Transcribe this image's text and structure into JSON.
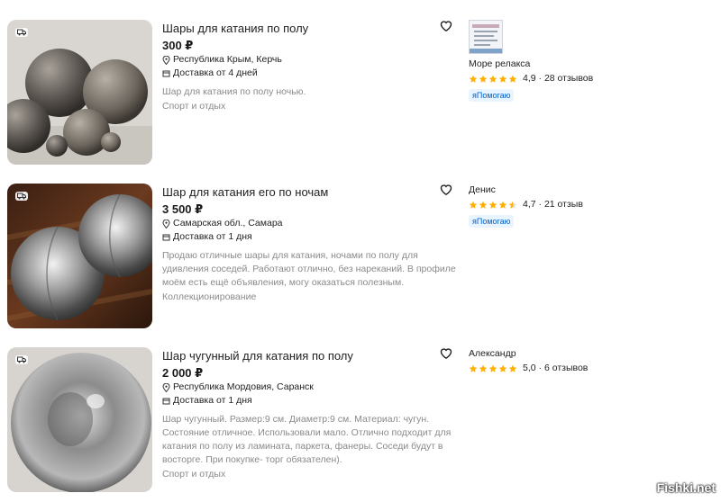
{
  "listings": [
    {
      "title": "Шары для катания по полу",
      "price": "300 ₽",
      "location": "Республика Крым, Керчь",
      "delivery": "Доставка от 4 дней",
      "description": "Шар для катания по полу ночью.",
      "category": "Спорт и отдых",
      "seller": {
        "name": "Море релакса",
        "rating": "4,9",
        "reviews": "28 отзывов",
        "stars": 5,
        "badge": "яПомогаю"
      }
    },
    {
      "title": "Шар для катания его по ночам",
      "price": "3 500 ₽",
      "location": "Самарская обл., Самара",
      "delivery": "Доставка от 1 дня",
      "description": "Продаю отличные шары для катания, ночами по полу для удивления соседей. Работают отлично, без нареканий. В профиле моём есть ещё объявления, могу оказаться полезным.",
      "category": "Коллекционирование",
      "seller": {
        "name": "Денис",
        "rating": "4,7",
        "reviews": "21 отзыв",
        "stars": 4.5,
        "badge": "яПомогаю"
      }
    },
    {
      "title": "Шар чугунный для катания по полу",
      "price": "2 000 ₽",
      "location": "Республика Мордовия, Саранск",
      "delivery": "Доставка от 1 дня",
      "description": "Шар чугунный. Размер:9 см. Диаметр:9 см. Материал: чугун. Состояние отличное. Использовали мало. Отлично подходит для катания по полу из ламината, паркета, фанеры. Соседи будут в восторге. При покупке- торг обязателен).",
      "category": "Спорт и отдых",
      "seller": {
        "name": "Александр",
        "rating": "5,0",
        "reviews": "6 отзывов",
        "stars": 5
      }
    }
  ],
  "watermark": "Fishki.net",
  "colors": {
    "star": "#ffb000",
    "badge_bg": "#e8f4ff",
    "badge_text": "#005fcc"
  },
  "icons": [
    "delivery-truck-icon",
    "location-pin-icon",
    "box-icon",
    "heart-icon",
    "star-icon"
  ]
}
